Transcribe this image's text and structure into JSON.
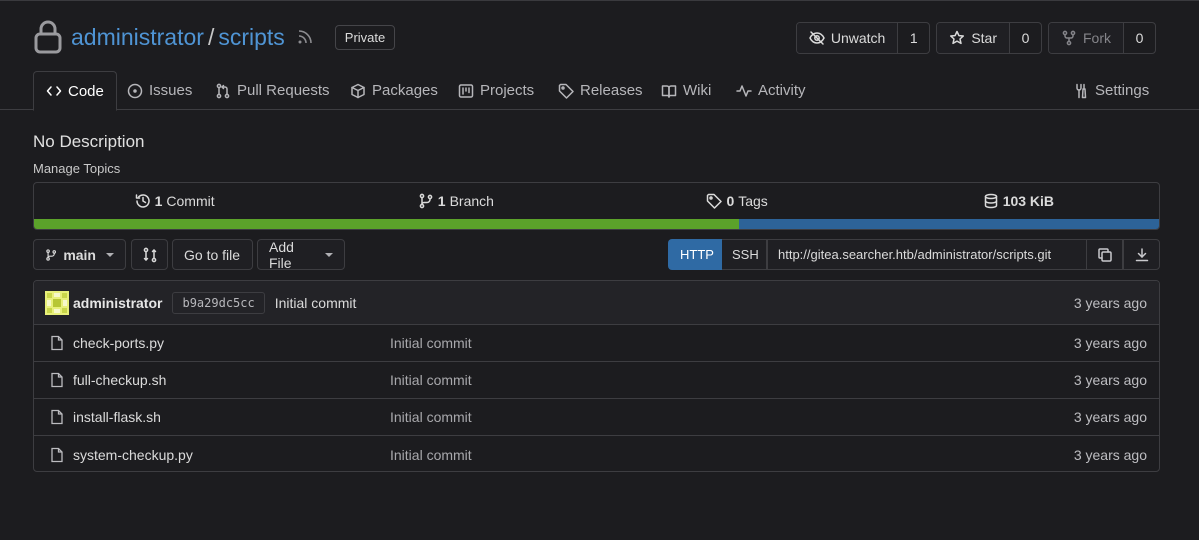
{
  "repo": {
    "owner": "administrator",
    "separator": "/",
    "name": "scripts",
    "visibility": "Private"
  },
  "actions": {
    "watch": {
      "label": "Unwatch",
      "count": "1"
    },
    "star": {
      "label": "Star",
      "count": "0"
    },
    "fork": {
      "label": "Fork",
      "count": "0"
    }
  },
  "tabs": [
    {
      "label": "Code",
      "icon": "code-icon",
      "active": true
    },
    {
      "label": "Issues",
      "icon": "issue-icon"
    },
    {
      "label": "Pull Requests",
      "icon": "pull-request-icon"
    },
    {
      "label": "Packages",
      "icon": "package-icon"
    },
    {
      "label": "Projects",
      "icon": "project-icon"
    },
    {
      "label": "Releases",
      "icon": "tag-icon"
    },
    {
      "label": "Wiki",
      "icon": "book-icon"
    },
    {
      "label": "Activity",
      "icon": "pulse-icon"
    },
    {
      "label": "Settings",
      "icon": "tools-icon"
    }
  ],
  "description": "No Description",
  "manage_topics": "Manage Topics",
  "stats": {
    "commits": {
      "count": "1",
      "label": "Commit"
    },
    "branches": {
      "count": "1",
      "label": "Branch"
    },
    "tags": {
      "count": "0",
      "label": "Tags"
    },
    "size": "103 KiB"
  },
  "languages": [
    {
      "color": "#5ba22a",
      "fraction": 0.627
    },
    {
      "color": "#2d6398",
      "fraction": 0.373
    }
  ],
  "toolbar": {
    "branch": "main",
    "go_to_file": "Go to file",
    "add_file": "Add File",
    "http": "HTTP",
    "ssh": "SSH",
    "clone_url": "http://gitea.searcher.htb/administrator/scripts.git"
  },
  "latest_commit": {
    "author": "administrator",
    "sha": "b9a29dc5cc",
    "message": "Initial commit",
    "time": "3 years ago"
  },
  "files": [
    {
      "name": "check-ports.py",
      "message": "Initial commit",
      "time": "3 years ago"
    },
    {
      "name": "full-checkup.sh",
      "message": "Initial commit",
      "time": "3 years ago"
    },
    {
      "name": "install-flask.sh",
      "message": "Initial commit",
      "time": "3 years ago"
    },
    {
      "name": "system-checkup.py",
      "message": "Initial commit",
      "time": "3 years ago"
    }
  ],
  "colors": {
    "accent": "#4f94d4",
    "background": "#1c1c1f",
    "http_button": "#2f6aa4"
  }
}
